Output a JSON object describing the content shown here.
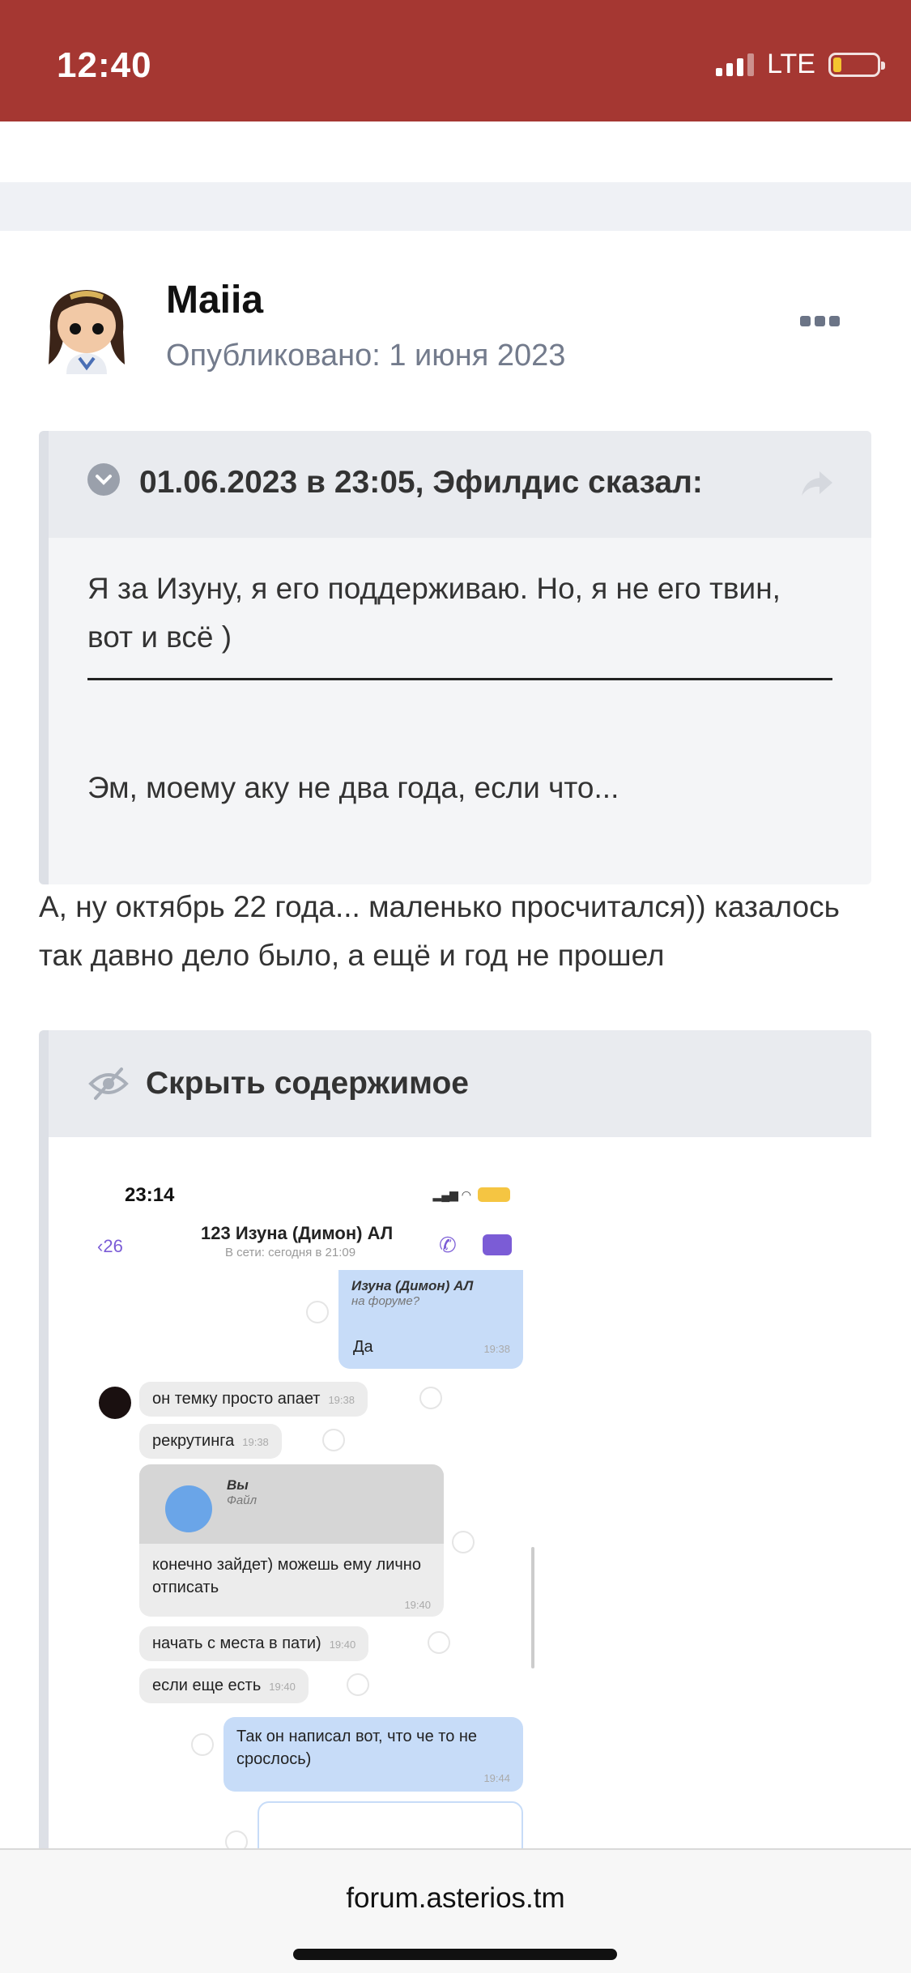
{
  "status_bar": {
    "time": "12:40",
    "network": "LTE",
    "battery_color": "#f4c430",
    "background": "#a53732"
  },
  "post": {
    "author": "Maiia",
    "posted": "Опубликовано: 1 июня 2023",
    "more_icon": "ellipsis-icon",
    "quote": {
      "cite": "01.06.2023 в 23:05, Эфилдис сказал:",
      "text1": "Я за Изуну, я его поддерживаю. Но, я не его твин, вот и всё )",
      "text2": "Эм, моему аку не два года, если что..."
    },
    "text": "А, ну октябрь 22 года... маленько просчитался)) казалось так давно дело было, а ещё и год не прошел",
    "spoiler": {
      "title": "Скрыть содержимое",
      "screenshot": {
        "time": "23:14",
        "back": "26",
        "chat_title": "123 Изуна (Димон) АЛ",
        "chat_subtitle": "В сети: сегодня в 21:09",
        "reply_preview_name": "Изуна (Димон) АЛ",
        "reply_preview_text": "на форуме?",
        "msg_da": "Да",
        "msg_da_time": "19:38",
        "msg1": "он темку просто апает",
        "msg1_time": "19:38",
        "msg2": "рекрутинга",
        "msg2_time": "19:38",
        "reply_you": "Вы",
        "reply_file": "Файл",
        "msg3": "конечно зайдет) можешь ему лично отписать",
        "msg3_time": "19:40",
        "msg4": "начать с места в пати)",
        "msg4_time": "19:40",
        "msg5": "если еще есть",
        "msg5_time": "19:40",
        "msg6": "Так он написал вот, что че то не срослось)",
        "msg6_time": "19:44"
      }
    }
  },
  "browser": {
    "url": "forum.asterios.tm"
  }
}
